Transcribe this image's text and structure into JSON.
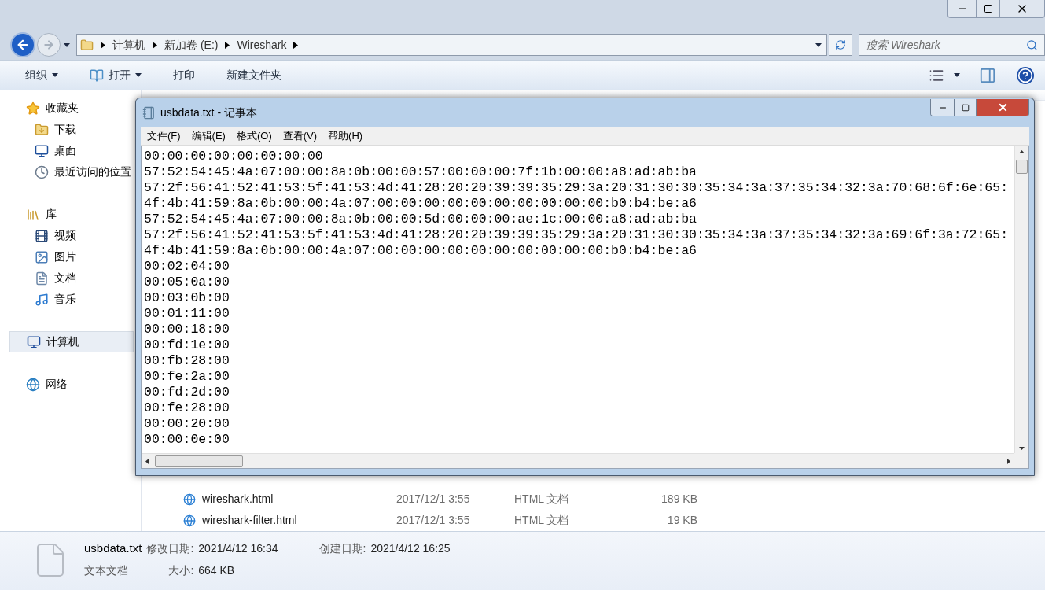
{
  "explorer": {
    "breadcrumb": [
      "计算机",
      "新加卷 (E:)",
      "Wireshark"
    ],
    "search": {
      "placeholder": "搜索 Wireshark"
    },
    "toolbar": [
      {
        "label": "组织",
        "kind": "menu"
      },
      {
        "label": "打开",
        "kind": "open-menu"
      },
      {
        "label": "打印",
        "kind": "command"
      },
      {
        "label": "新建文件夹",
        "kind": "command"
      }
    ],
    "nav": [
      {
        "label": "收藏夹",
        "kind": "favorites",
        "selected": false,
        "children": [
          {
            "label": "下载",
            "kind": "downloads",
            "selected": false
          },
          {
            "label": "桌面",
            "kind": "desktop",
            "selected": false
          },
          {
            "label": "最近访问的位置",
            "kind": "recent",
            "selected": false
          }
        ]
      },
      {
        "label": "库",
        "kind": "libraries",
        "selected": false,
        "children": [
          {
            "label": "视频",
            "kind": "videos",
            "selected": false
          },
          {
            "label": "图片",
            "kind": "pictures",
            "selected": false
          },
          {
            "label": "文档",
            "kind": "documents",
            "selected": false
          },
          {
            "label": "音乐",
            "kind": "music",
            "selected": false
          }
        ]
      },
      {
        "label": "计算机",
        "kind": "computer",
        "selected": true
      },
      {
        "label": "网络",
        "kind": "network",
        "selected": false
      }
    ],
    "files": [
      {
        "name": "wireshark.html",
        "modified": "2017/12/1 3:55",
        "type": "HTML 文档",
        "size": "189 KB",
        "kind": "html"
      },
      {
        "name": "wireshark-filter.html",
        "modified": "2017/12/1 3:55",
        "type": "HTML 文档",
        "size": "19 KB",
        "kind": "html"
      }
    ],
    "details": {
      "name": "usbdata.txt",
      "modified_label": "修改日期:",
      "modified": "2021/4/12 16:34",
      "created_label": "创建日期:",
      "created": "2021/4/12 16:25",
      "type": "文本文档",
      "size_label": "大小:",
      "size": "664 KB"
    }
  },
  "notepad": {
    "title": "usbdata.txt - 记事本",
    "menu": [
      "文件(F)",
      "编辑(E)",
      "格式(O)",
      "查看(V)",
      "帮助(H)"
    ],
    "lines": [
      "00:00:00:00:00:00:00:00",
      "57:52:54:45:4a:07:00:00:8a:0b:00:00:57:00:00:00:7f:1b:00:00:a8:ad:ab:ba",
      "57:2f:56:41:52:41:53:5f:41:53:4d:41:28:20:20:39:39:35:29:3a:20:31:30:30:35:34:3a:37:35:34:32:3a:70:68:6f:6e:65:",
      "4f:4b:41:59:8a:0b:00:00:4a:07:00:00:00:00:00:00:00:00:00:00:b0:b4:be:a6",
      "57:52:54:45:4a:07:00:00:8a:0b:00:00:5d:00:00:00:ae:1c:00:00:a8:ad:ab:ba",
      "57:2f:56:41:52:41:53:5f:41:53:4d:41:28:20:20:39:39:35:29:3a:20:31:30:30:35:34:3a:37:35:34:32:3a:69:6f:3a:72:65:",
      "4f:4b:41:59:8a:0b:00:00:4a:07:00:00:00:00:00:00:00:00:00:00:b0:b4:be:a6",
      "00:02:04:00",
      "00:05:0a:00",
      "00:03:0b:00",
      "00:01:11:00",
      "00:00:18:00",
      "00:fd:1e:00",
      "00:fb:28:00",
      "00:fe:2a:00",
      "00:fd:2d:00",
      "00:fe:28:00",
      "00:00:20:00",
      "00:00:0e:00"
    ]
  }
}
